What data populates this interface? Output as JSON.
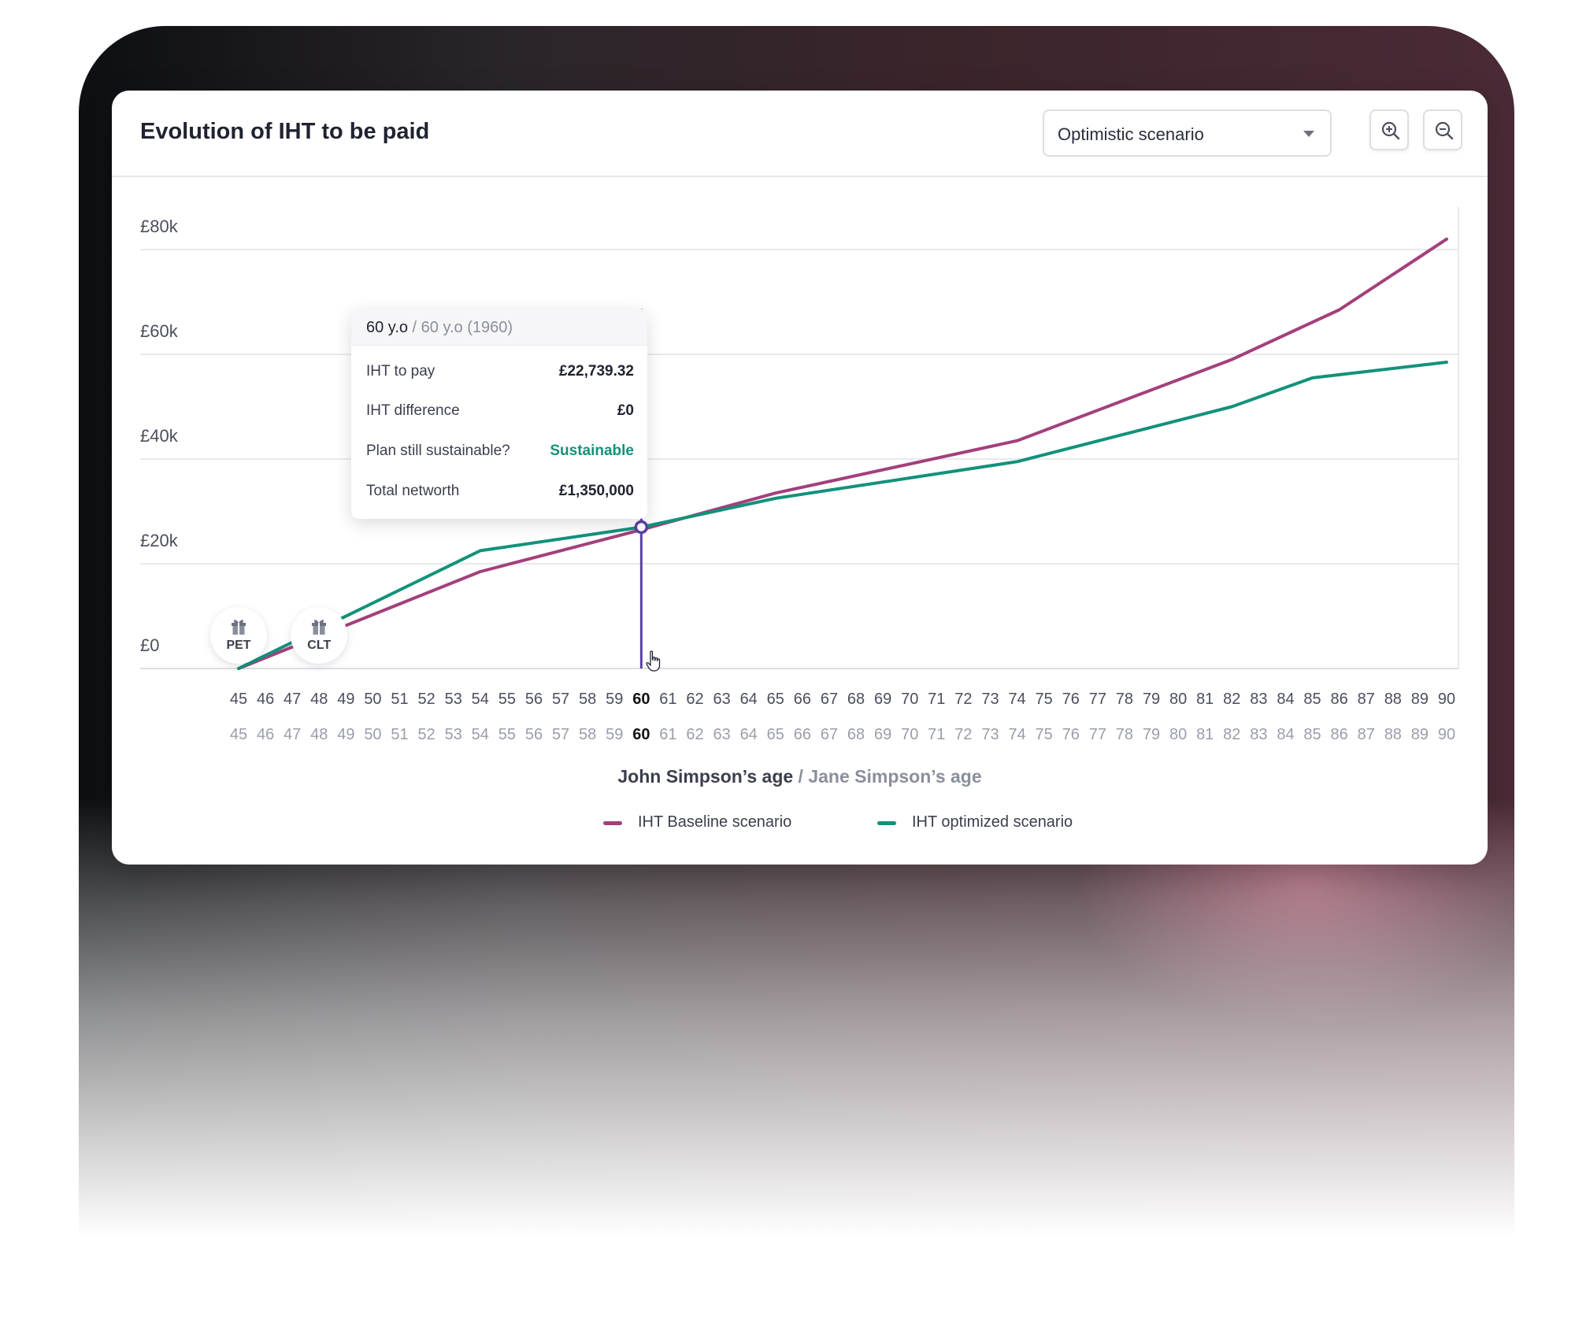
{
  "header": {
    "title": "Evolution of IHT to be paid",
    "scenario_select": {
      "value": "Optimistic scenario"
    },
    "zoom_in_icon": "zoom-in-icon",
    "zoom_out_icon": "zoom-out-icon"
  },
  "tooltip": {
    "age_primary": "60 y.o",
    "age_separator": " / ",
    "age_secondary": "60 y.o (1960)",
    "rows": [
      {
        "label": "IHT to pay",
        "value": "£22,739.32"
      },
      {
        "label": "IHT difference",
        "value": "£0"
      },
      {
        "label": "Plan still sustainable?",
        "value": "Sustainable"
      },
      {
        "label": "Total networth",
        "value": "£1,350,000"
      }
    ]
  },
  "events": [
    {
      "label": "PET",
      "age": 45,
      "icon": "gift-icon"
    },
    {
      "label": "CLT",
      "age": 48,
      "icon": "gift-icon"
    }
  ],
  "axis_title": {
    "primary": "John Simpson’s age",
    "separator": " / ",
    "secondary": "Jane Simpson’s age"
  },
  "legend": [
    {
      "label": "IHT Baseline scenario",
      "color": "#a3407c"
    },
    {
      "label": "IHT optimized scenario",
      "color": "#13917b"
    }
  ],
  "colors": {
    "baseline": "#a3407c",
    "optimized": "#13917b",
    "crosshair": "#5b3fa8"
  },
  "chart_data": {
    "type": "line",
    "title": "Evolution of IHT to be paid",
    "xlabel": "John Simpson’s age / Jane Simpson’s age",
    "ylabel": "",
    "x": [
      45,
      46,
      47,
      48,
      49,
      50,
      51,
      52,
      53,
      54,
      55,
      56,
      57,
      58,
      59,
      60,
      61,
      62,
      63,
      64,
      65,
      66,
      67,
      68,
      69,
      70,
      71,
      72,
      73,
      74,
      75,
      76,
      77,
      78,
      79,
      80,
      81,
      82,
      83,
      84,
      85,
      86,
      87,
      88,
      89,
      90
    ],
    "x_secondary": [
      45,
      46,
      47,
      48,
      49,
      50,
      51,
      52,
      53,
      54,
      55,
      56,
      57,
      58,
      59,
      60,
      61,
      62,
      63,
      64,
      65,
      66,
      67,
      68,
      69,
      70,
      71,
      72,
      73,
      74,
      75,
      76,
      77,
      78,
      79,
      80,
      81,
      82,
      83,
      84,
      85,
      86,
      87,
      88,
      89,
      90
    ],
    "highlight_x": 60,
    "y_ticks": [
      "£0",
      "£20k",
      "£40k",
      "£60k",
      "£80k"
    ],
    "y_tick_values": [
      0,
      20000,
      40000,
      60000,
      80000
    ],
    "ylim": [
      0,
      80000
    ],
    "grid": true,
    "legend_position": "bottom",
    "series": [
      {
        "name": "IHT Baseline scenario",
        "points": [
          [
            45,
            0
          ],
          [
            54,
            18500
          ],
          [
            60,
            26500
          ],
          [
            65,
            33500
          ],
          [
            74,
            43500
          ],
          [
            82,
            59000
          ],
          [
            86,
            68500
          ],
          [
            90,
            82000
          ]
        ]
      },
      {
        "name": "IHT optimized scenario",
        "points": [
          [
            45,
            0
          ],
          [
            54,
            22500
          ],
          [
            60,
            27000
          ],
          [
            65,
            32500
          ],
          [
            74,
            39500
          ],
          [
            82,
            50000
          ],
          [
            85,
            55500
          ],
          [
            90,
            58500
          ]
        ]
      }
    ]
  }
}
